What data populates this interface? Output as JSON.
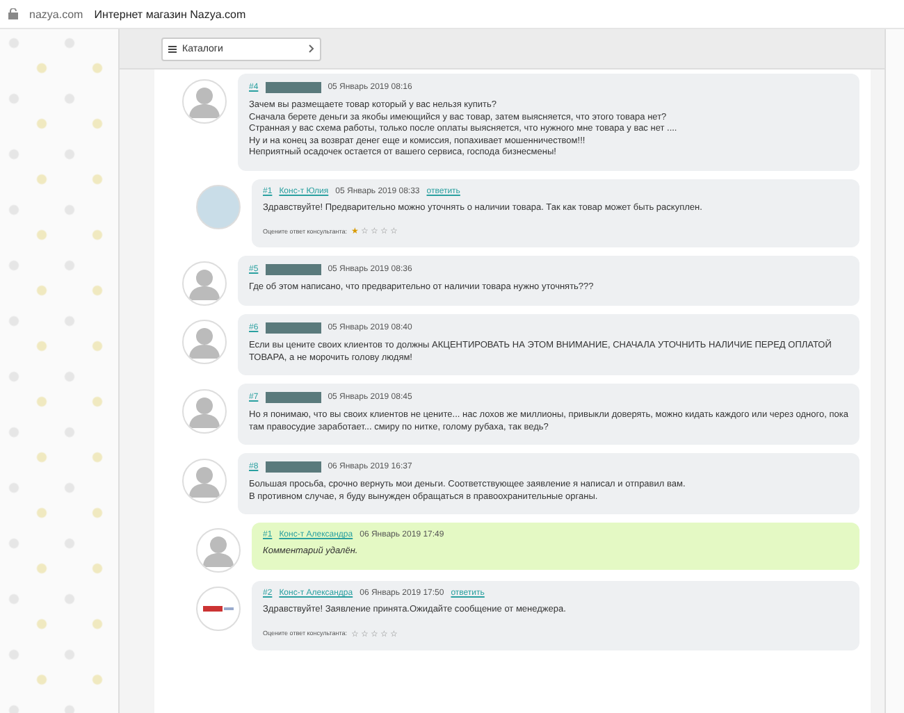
{
  "browser": {
    "domain": "nazya.com",
    "title": "Интернет магазин Nazya.com"
  },
  "catalog": {
    "label": "Каталоги"
  },
  "comments": [
    {
      "avatar": {
        "kind": "person"
      },
      "reply": false,
      "highlighted": false,
      "number": "#4",
      "author": {
        "kind": "hidden"
      },
      "date": "05 Январь 2019 08:16",
      "text": "Зачем вы размещаете товар который у вас нельзя купить?\nСначала берете деньги за якобы имеющийся у вас товар, затем выясняется, что этого товара нет?\nСтранная у вас схема работы, только после оплаты выясняется, что нужного мне товара у вас нет ....\nНу и на конец за возврат денег еще и комиссия, попахивает мошенничеством!!!\nНеприятный осадочек остается от вашего сервиса, господа бизнесмены!"
    },
    {
      "avatar": {
        "kind": "photo"
      },
      "reply": true,
      "highlighted": false,
      "number": "#1",
      "author": {
        "kind": "named",
        "name": "Конс-т Юлия"
      },
      "date": "05 Январь 2019 08:33",
      "reply_link": "ответить",
      "text": "Здравствуйте! Предварительно можно уточнять о наличии товара. Так как товар может быть раскуплен.",
      "rating": {
        "label": "Оцените ответ консультанта:",
        "stars": 1
      }
    },
    {
      "avatar": {
        "kind": "person"
      },
      "reply": false,
      "highlighted": false,
      "number": "#5",
      "author": {
        "kind": "hidden"
      },
      "date": "05 Январь 2019 08:36",
      "text": "Где об этом написано, что предварительно от наличии товара нужно уточнять???"
    },
    {
      "avatar": {
        "kind": "person"
      },
      "reply": false,
      "highlighted": false,
      "number": "#6",
      "author": {
        "kind": "hidden"
      },
      "date": "05 Январь 2019 08:40",
      "text": "Если вы цените своих клиентов то должны АКЦЕНТИРОВАТЬ НА ЭТОМ ВНИМАНИЕ, СНАЧАЛА УТОЧНИТЬ НАЛИЧИЕ ПЕРЕД ОПЛАТОЙ\nТОВАРА, а не морочить голову людям!"
    },
    {
      "avatar": {
        "kind": "person"
      },
      "reply": false,
      "highlighted": false,
      "number": "#7",
      "author": {
        "kind": "hidden"
      },
      "date": "05 Январь 2019 08:45",
      "text": "Но я понимаю, что вы своих клиентов не цените... нас лохов же миллионы, привыкли доверять, можно кидать каждого или через одного, пока\nтам правосудие заработает... смиру по нитке, голому рубаха, так ведь?"
    },
    {
      "avatar": {
        "kind": "person"
      },
      "reply": false,
      "highlighted": false,
      "number": "#8",
      "author": {
        "kind": "hidden"
      },
      "date": "06 Январь 2019 16:37",
      "text": "Большая просьба, срочно вернуть мои деньги. Соответствующее заявление я написал и отправил вам.\nВ противном случае, я буду вынужден обращаться в правоохранительные органы."
    },
    {
      "avatar": {
        "kind": "person"
      },
      "reply": true,
      "highlighted": true,
      "number": "#1",
      "author": {
        "kind": "named",
        "name": "Конс-т Александра"
      },
      "date": "06 Январь 2019 17:49",
      "text": "Комментарий удалён.",
      "italic": true
    },
    {
      "avatar": {
        "kind": "logo"
      },
      "reply": true,
      "highlighted": false,
      "number": "#2",
      "author": {
        "kind": "named",
        "name": "Конс-т Александра"
      },
      "date": "06 Январь 2019 17:50",
      "reply_link": "ответить",
      "text": "Здравствуйте! Заявление принята.Ожидайте сообщение от менеджера.",
      "rating": {
        "label": "Оцените ответ консультанта:",
        "stars": 0
      }
    }
  ]
}
